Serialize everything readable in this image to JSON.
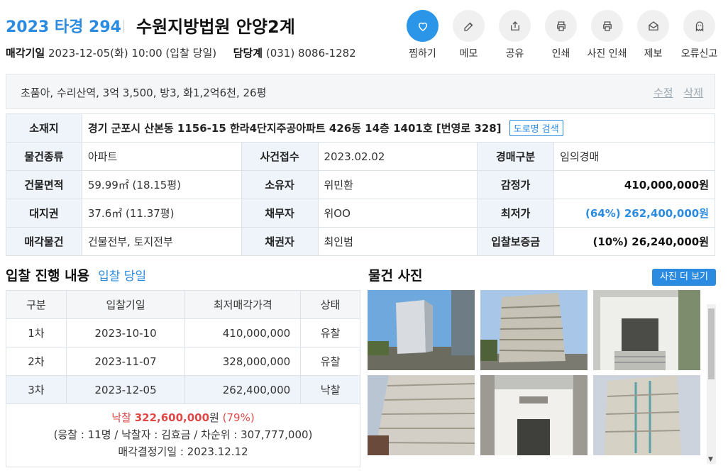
{
  "header": {
    "case_no": "2023 타경 294",
    "court": "수원지방법원 안양2계",
    "sale_date_label": "매각기일",
    "sale_date": "2023-12-05(화) 10:00 (입찰 당일)",
    "dept_label": "담당계",
    "dept_phone": "(031) 8086-1282"
  },
  "actions": [
    {
      "label": "찜하기",
      "icon": "heart-icon"
    },
    {
      "label": "메모",
      "icon": "edit-icon"
    },
    {
      "label": "공유",
      "icon": "share-icon"
    },
    {
      "label": "인쇄",
      "icon": "print-icon"
    },
    {
      "label": "사진 인쇄",
      "icon": "print-icon"
    },
    {
      "label": "제보",
      "icon": "mail-icon"
    },
    {
      "label": "오류신고",
      "icon": "ghost-icon"
    }
  ],
  "summary": {
    "text": "초품아, 수리산역, 3억 3,500, 방3, 화1,2억6천, 26평",
    "edit": "수정",
    "delete": "삭제"
  },
  "info": {
    "location_label": "소재지",
    "location": "경기 군포시 산본동 1156-15 한라4단지주공아파트 426동 14층 1401호 [번영로 328]",
    "road_search": "도로명 검색",
    "type_label": "물건종류",
    "type": "아파트",
    "received_label": "사건접수",
    "received": "2023.02.02",
    "auction_type_label": "경매구분",
    "auction_type": "임의경매",
    "area_label": "건물면적",
    "area": "59.99㎡ (18.15평)",
    "owner_label": "소유자",
    "owner": "위민환",
    "appraisal_label": "감정가",
    "appraisal": "410,000,000원",
    "land_label": "대지권",
    "land": "37.6㎡ (11.37평)",
    "debtor_label": "채무자",
    "debtor": "위OO",
    "min_label": "최저가",
    "min": "(64%) 262,400,000원",
    "sale_item_label": "매각물건",
    "sale_item": "건물전부, 토지전부",
    "creditor_label": "채권자",
    "creditor": "최인범",
    "deposit_label": "입찰보증금",
    "deposit": "(10%) 26,240,000원"
  },
  "bids": {
    "title": "입찰 진행 내용",
    "subtitle": "입찰 당일",
    "columns": [
      "구분",
      "입찰기일",
      "최저매각가격",
      "상태"
    ],
    "rows": [
      [
        "1차",
        "2023-10-10",
        "410,000,000",
        "유찰"
      ],
      [
        "2차",
        "2023-11-07",
        "328,000,000",
        "유찰"
      ],
      [
        "3차",
        "2023-12-05",
        "262,400,000",
        "낙찰"
      ]
    ],
    "result_word": "낙찰",
    "result_price": "322,600,000",
    "result_won": "원",
    "result_pct": "(79%)",
    "result_detail": "(응찰 : 11명 / 낙찰자 : 김효금 / 차순위 : 307,777,000)",
    "result_decision": "매각결정기일 : 2023.12.12"
  },
  "photos": {
    "title": "물건 사진",
    "more": "사진 더 보기"
  },
  "colors": {
    "accent": "#2b8be0",
    "red": "#e04848"
  }
}
